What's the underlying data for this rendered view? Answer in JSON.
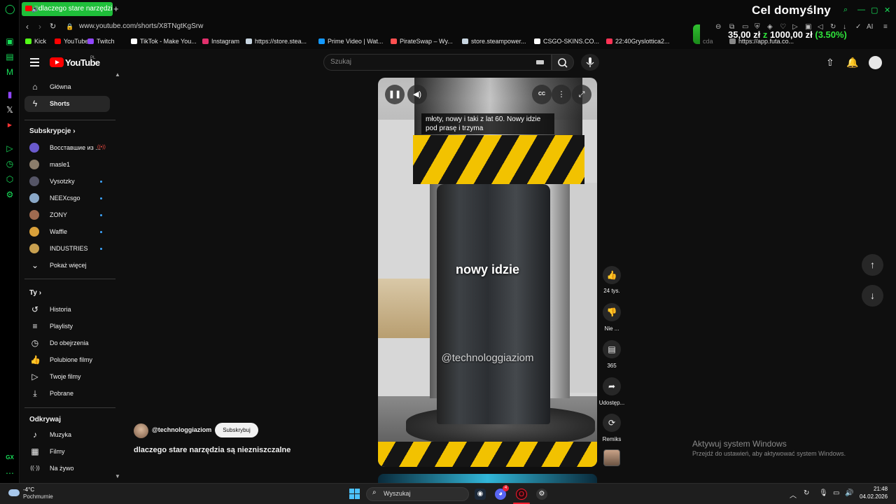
{
  "browser": {
    "tab_title": "dlaczego stare narzędzi",
    "url": "www.youtube.com/shorts/X8TNgtKgSrw",
    "bookmarks": [
      {
        "label": "Kick",
        "color": "#53fc18"
      },
      {
        "label": "YouTube",
        "color": "#ff0000"
      },
      {
        "label": "Twitch",
        "color": "#9146ff"
      },
      {
        "label": "TikTok - Make You...",
        "color": "#ffffff"
      },
      {
        "label": "Instagram",
        "color": "#e1306c"
      },
      {
        "label": "https://store.stea...",
        "color": "#c7d5e0"
      },
      {
        "label": "Prime Video | Wat...",
        "color": "#1399ff"
      },
      {
        "label": "PirateSwap – Wy...",
        "color": "#ff5050"
      },
      {
        "label": "store.steampower...",
        "color": "#c7d5e0"
      },
      {
        "label": "CSGO-SKINS.CO...",
        "color": "#ffffff"
      },
      {
        "label": "22:40Gryslottica2...",
        "color": "#ff3355"
      },
      {
        "label": "https://app.futa.co...",
        "color": "#888888"
      }
    ],
    "extra_bookmark_hint": "cda"
  },
  "overlay": {
    "goal_title": "Cel domyślny",
    "current": "35,00 zł",
    "of_word": "z",
    "target": "1000,00 zł",
    "percent": "(3.50%)",
    "progress_fraction": 0.035
  },
  "youtube": {
    "logo_text": "YouTube",
    "region": "PL",
    "search_placeholder": "Szukaj",
    "nav_main": [
      {
        "label": "Główna",
        "icon": "home-icon"
      },
      {
        "label": "Shorts",
        "icon": "shorts-icon",
        "active": true
      }
    ],
    "subscriptions_title": "Subskrypcje",
    "subscriptions": [
      {
        "label": "Восставшие из ...",
        "color": "#6a5acd",
        "live": true
      },
      {
        "label": "masle1",
        "color": "#8b7d6b"
      },
      {
        "label": "Vysotzky",
        "color": "#556",
        "dot": true
      },
      {
        "label": "NEEXcsgo",
        "color": "#8aa8c8",
        "dot": true
      },
      {
        "label": "ZONY",
        "color": "#a06a50",
        "dot": true
      },
      {
        "label": "Waffle",
        "color": "#d9a03a",
        "dot": true
      },
      {
        "label": "INDUSTRIES",
        "color": "#c8a050",
        "dot": true
      }
    ],
    "show_more": "Pokaż więcej",
    "you_title": "Ty",
    "you_items": [
      {
        "label": "Historia",
        "icon": "history-icon"
      },
      {
        "label": "Playlisty",
        "icon": "playlist-icon"
      },
      {
        "label": "Do obejrzenia",
        "icon": "watch-later-icon"
      },
      {
        "label": "Polubione filmy",
        "icon": "like-icon"
      },
      {
        "label": "Twoje filmy",
        "icon": "your-videos-icon"
      },
      {
        "label": "Pobrane",
        "icon": "download-icon"
      }
    ],
    "explore_title": "Odkrywaj",
    "explore_items": [
      {
        "label": "Muzyka",
        "icon": "music-icon"
      },
      {
        "label": "Filmy",
        "icon": "movies-icon"
      },
      {
        "label": "Na żywo",
        "icon": "live-icon"
      }
    ]
  },
  "video": {
    "caption": "młoty, nowy i taki z lat 60. Nowy idzie pod prasę i trzyma",
    "center_text": "nowy idzie",
    "watermark": "@technologgiaziom",
    "cc_label": "CC",
    "channel": "@technologgiaziom",
    "subscribe_label": "Subskrybuj",
    "title": "dlaczego stare narzędzia są niezniszczalne"
  },
  "actions": {
    "likes": "24 tys.",
    "dislike": "Nie ...",
    "comments": "365",
    "share": "Udostęp...",
    "remix": "Remiks"
  },
  "windows": {
    "activate_title": "Aktywuj system Windows",
    "activate_sub": "Przejdź do ustawień, aby aktywować system Windows."
  },
  "taskbar": {
    "weather_temp": "-4°C",
    "weather_desc": "Pochmurnie",
    "search_label": "Wyszukaj",
    "time": "21:48",
    "date": "04.02.2026",
    "discord_badge": "4"
  }
}
